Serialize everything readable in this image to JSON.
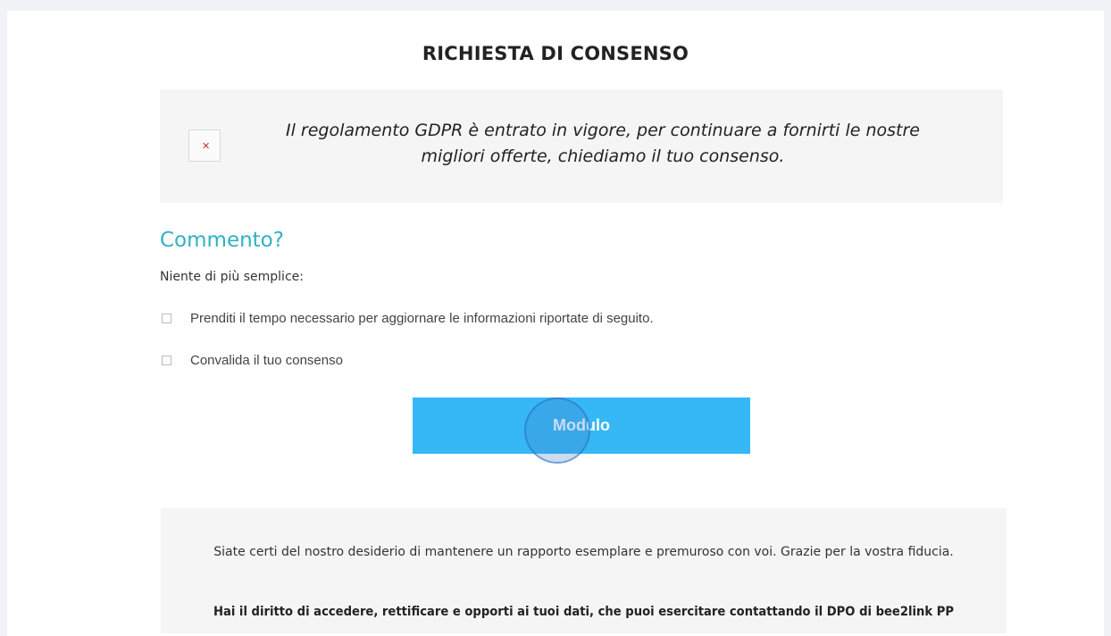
{
  "consent": {
    "title": "RICHIESTA DI CONSENSO",
    "notice": {
      "image_icon": "broken-image-icon",
      "text": "Il regolamento GDPR è entrato in vigore, per continuare a fornirti le nostre migliori offerte, chiediamo il tuo consenso."
    },
    "section_heading": "Commento?",
    "intro": "Niente di più semplice:",
    "checkboxes": [
      {
        "label": "Prenditi il tempo necessario per aggiornare le informazioni riportate di seguito.",
        "checked": false
      },
      {
        "label": "Convalida il tuo consenso",
        "checked": false
      }
    ],
    "button_label": "Modulo",
    "footer": {
      "paragraph1": "Siate certi del nostro desiderio di mantenere un rapporto esemplare e premuroso con voi. Grazie per la vostra fiducia.",
      "paragraph2": "Hai il diritto di accedere, rettificare e opporti ai tuoi dati, che puoi esercitare contattando il DPO di bee2link PP"
    }
  },
  "colors": {
    "accent": "#35b8f5",
    "heading": "#2fb2c4",
    "panel_bg": "#f5f5f5",
    "page_bg": "#f0f2f5"
  }
}
